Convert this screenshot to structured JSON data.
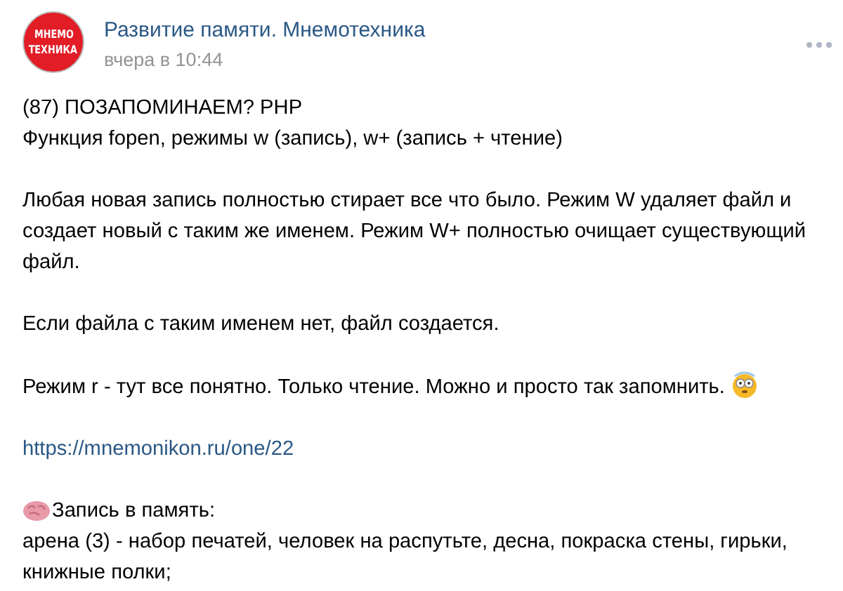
{
  "post": {
    "logo": [
      "МНЕМО",
      "ТЕХНИКА"
    ],
    "author": "Развитие памяти. Мнемотехника",
    "time": "вчера в 10:44",
    "blocks": [
      {
        "kind": "text",
        "text": "(87) ПОЗАПОМИНАЕМ? PHP\nФункция fopen, режимы w (запись), w+ (запись + чтение)"
      },
      {
        "kind": "text",
        "text": "Любая новая запись полностью стирает все что было. Режим W удаляет файл и\nсоздает новый с таким же именем. Режим W+ полностью очищает существующий\nфайл."
      },
      {
        "kind": "text",
        "text": "Если файла с таким именем нет, файл создается."
      },
      {
        "kind": "text_emoji",
        "text": "Режим r - тут все понятно. Только чтение. Можно и просто так запомнить."
      },
      {
        "kind": "link",
        "text": "https://mnemonikon.ru/one/22"
      },
      {
        "kind": "brain_heading",
        "text": "Запись в память:",
        "next": "арена (3) - набор печатей, человек на распутьте, десна, покраска стены, гирьки,\nкнижные полки;"
      }
    ]
  }
}
